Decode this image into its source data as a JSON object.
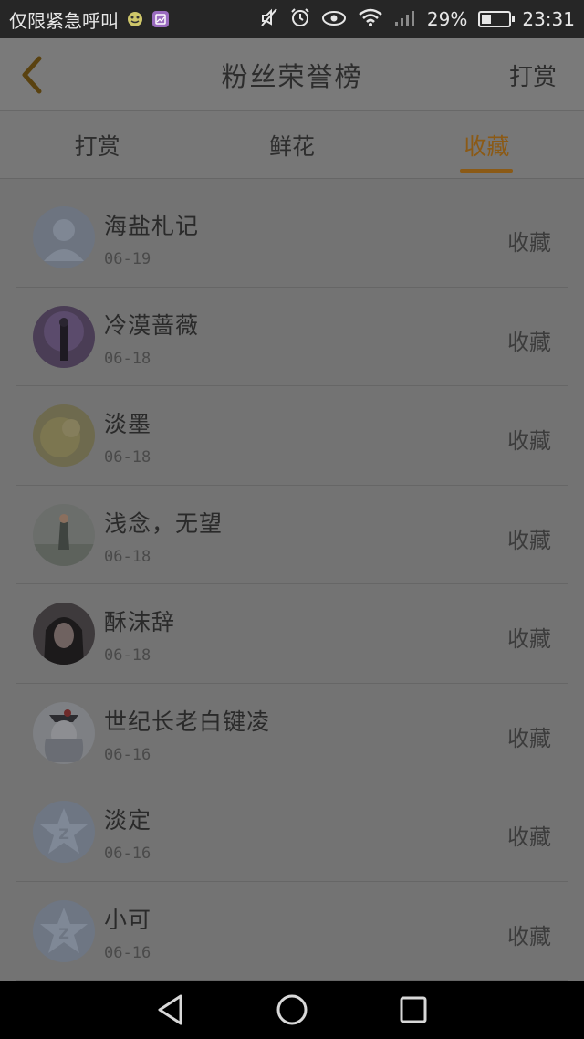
{
  "status_bar": {
    "carrier": "仅限紧急呼叫",
    "battery": "29%",
    "battery_level": 0.29,
    "time": "23:31"
  },
  "header": {
    "title": "粉丝荣誉榜",
    "action": "打赏"
  },
  "tabs": [
    {
      "label": "打赏",
      "active": false
    },
    {
      "label": "鲜花",
      "active": false
    },
    {
      "label": "收藏",
      "active": true
    }
  ],
  "accent_color": "#8b5a16",
  "fans": [
    {
      "name": "海盐札记",
      "date": "06-19",
      "action": "收藏",
      "avatar": "default-person-avatar"
    },
    {
      "name": "冷漠蔷薇",
      "date": "06-18",
      "action": "收藏",
      "avatar": "photo-avatar"
    },
    {
      "name": "淡墨",
      "date": "06-18",
      "action": "收藏",
      "avatar": "photo-avatar"
    },
    {
      "name": "浅念，无望",
      "date": "06-18",
      "action": "收藏",
      "avatar": "photo-avatar"
    },
    {
      "name": "酥沫辞",
      "date": "06-18",
      "action": "收藏",
      "avatar": "photo-avatar"
    },
    {
      "name": "世纪长老白键凌",
      "date": "06-16",
      "action": "收藏",
      "avatar": "photo-avatar"
    },
    {
      "name": "淡定",
      "date": "06-16",
      "action": "收藏",
      "avatar": "qq-star-avatar"
    },
    {
      "name": "小可",
      "date": "06-16",
      "action": "收藏",
      "avatar": "qq-star-avatar"
    }
  ]
}
